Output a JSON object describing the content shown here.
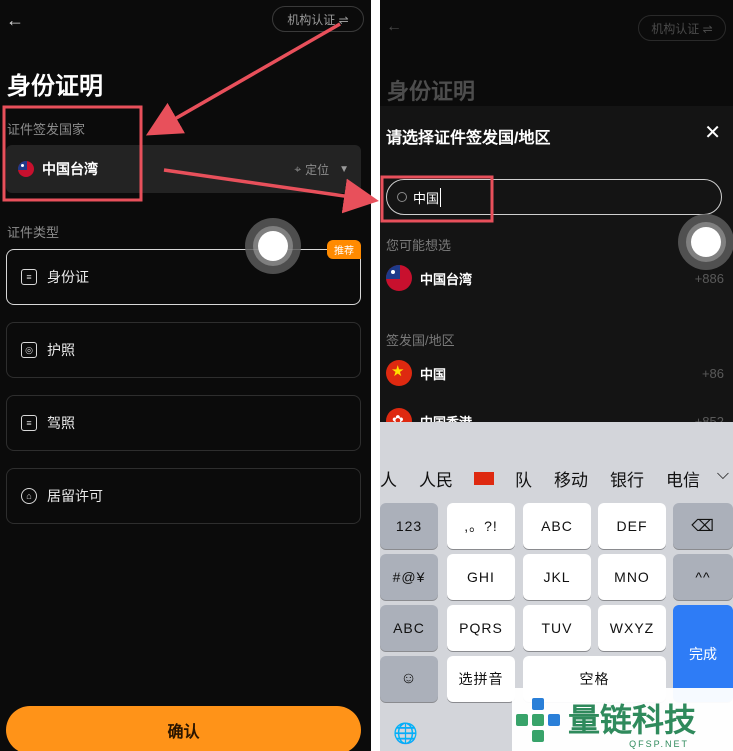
{
  "left_screen": {
    "org_button": "机构认证 ⇌",
    "title": "身份证明",
    "country_label": "证件签发国家",
    "country_value": "中国台湾",
    "locate_label": "定位",
    "doc_type_label": "证件类型",
    "doc_types": [
      {
        "label": "身份证",
        "icon": "id-card-icon",
        "selected": true,
        "badge": "推荐"
      },
      {
        "label": "护照",
        "icon": "passport-icon",
        "selected": false
      },
      {
        "label": "驾照",
        "icon": "driver-license-icon",
        "selected": false
      },
      {
        "label": "居留许可",
        "icon": "residence-permit-icon",
        "selected": false
      }
    ],
    "confirm_button": "确认"
  },
  "right_screen": {
    "background_org_button": "机构认证 ⇌",
    "background_title": "身份证明",
    "sheet_title": "请选择证件签发国/地区",
    "search_value": "中国",
    "suggest_label": "您可能想选",
    "suggestions": [
      {
        "name": "中国台湾",
        "code": "+886",
        "flag": "tw"
      }
    ],
    "issuer_label": "签发国/地区",
    "issuers": [
      {
        "name": "中国",
        "code": "+86",
        "flag": "cn"
      },
      {
        "name": "中国香港",
        "code": "+852",
        "flag": "hk"
      }
    ]
  },
  "keyboard": {
    "candidates": [
      "人",
      "人民",
      "🇨🇳",
      "队",
      "移动",
      "银行",
      "电信"
    ],
    "rows": [
      [
        "123",
        ",。?!",
        "ABC",
        "DEF",
        "⌫"
      ],
      [
        "#@¥",
        "GHI",
        "JKL",
        "MNO",
        "^^"
      ],
      [
        "ABC",
        "PQRS",
        "TUV",
        "WXYZ",
        "完成"
      ],
      [
        "☺",
        "选拼音",
        "空格"
      ]
    ]
  },
  "watermark": {
    "text": "量链科技",
    "subtext": "QFSP.NET"
  },
  "colors": {
    "accent_orange": "#ff9318",
    "annotation_red": "#e8505b",
    "keyboard_blue": "#2e7cf6"
  }
}
